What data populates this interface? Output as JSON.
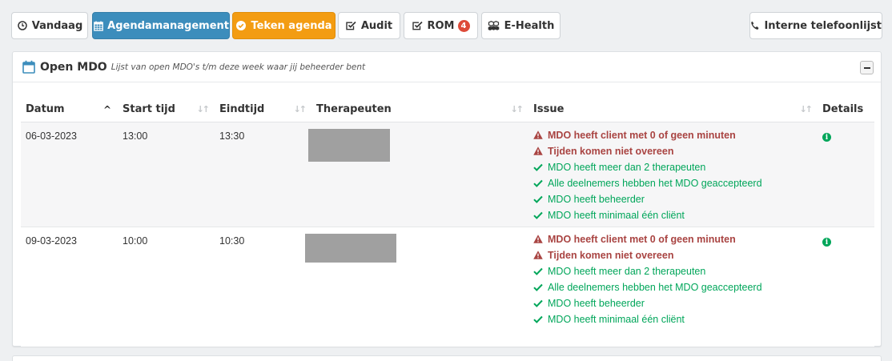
{
  "toolbar": {
    "vandaag": "Vandaag",
    "agendamanagement": "Agendamanagement",
    "teken_agenda": "Teken agenda",
    "audit": "Audit",
    "rom": "ROM",
    "rom_badge": "4",
    "ehealth": "E-Health",
    "telefoonlijst": "Interne telefoonlijst"
  },
  "panel": {
    "title": "Open MDO",
    "subtitle": "Lijst van open MDO's t/m deze week waar jij beheerder bent"
  },
  "table": {
    "headers": [
      "Datum",
      "Start tijd",
      "Eindtijd",
      "Therapeuten",
      "Issue",
      "Details"
    ],
    "rows": [
      {
        "datum": "06-03-2023",
        "start": "13:00",
        "eind": "13:30",
        "issues": [
          {
            "type": "warn",
            "text": "MDO heeft client met 0 of geen minuten"
          },
          {
            "type": "warn",
            "text": "Tijden komen niet overeen"
          },
          {
            "type": "ok",
            "text": "MDO heeft meer dan 2 therapeuten"
          },
          {
            "type": "ok",
            "text": "Alle deelnemers hebben het MDO geaccepteerd"
          },
          {
            "type": "ok",
            "text": "MDO heeft beheerder"
          },
          {
            "type": "ok",
            "text": "MDO heeft minimaal één cliënt"
          }
        ]
      },
      {
        "datum": "09-03-2023",
        "start": "10:00",
        "eind": "10:30",
        "issues": [
          {
            "type": "warn",
            "text": "MDO heeft client met 0 of geen minuten"
          },
          {
            "type": "warn",
            "text": "Tijden komen niet overeen"
          },
          {
            "type": "ok",
            "text": "MDO heeft meer dan 2 therapeuten"
          },
          {
            "type": "ok",
            "text": "Alle deelnemers hebben het MDO geaccepteerd"
          },
          {
            "type": "ok",
            "text": "MDO heeft beheerder"
          },
          {
            "type": "ok",
            "text": "MDO heeft minimaal één cliënt"
          }
        ]
      }
    ]
  },
  "colors": {
    "primary": "#3c8dbc",
    "warning": "#f39c12",
    "danger_text": "#a94442",
    "success": "#00a65a",
    "badge": "#dd4b39"
  }
}
